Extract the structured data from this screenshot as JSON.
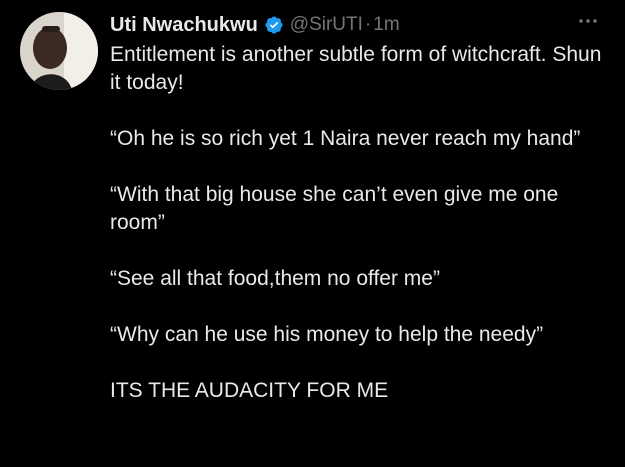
{
  "tweet": {
    "author": {
      "name": "Uti Nwachukwu",
      "handle": "@SirUTI",
      "verified": true
    },
    "separator": "·",
    "time": "1m",
    "more_icon": "more-horizontal-icon",
    "paragraphs": [
      "Entitlement is another subtle form of witchcraft. Shun it today!",
      "“Oh he is so rich yet 1 Naira never reach my hand”",
      "“With that big house she can’t even give me one room”",
      "“See all that food,them no offer me”",
      "“Why can he use his money to help the needy”",
      "ITS THE AUDACITY FOR ME"
    ]
  },
  "colors": {
    "background": "#000000",
    "text": "#e7e9ea",
    "secondary": "#71767b",
    "verified": "#1d9bf0"
  }
}
